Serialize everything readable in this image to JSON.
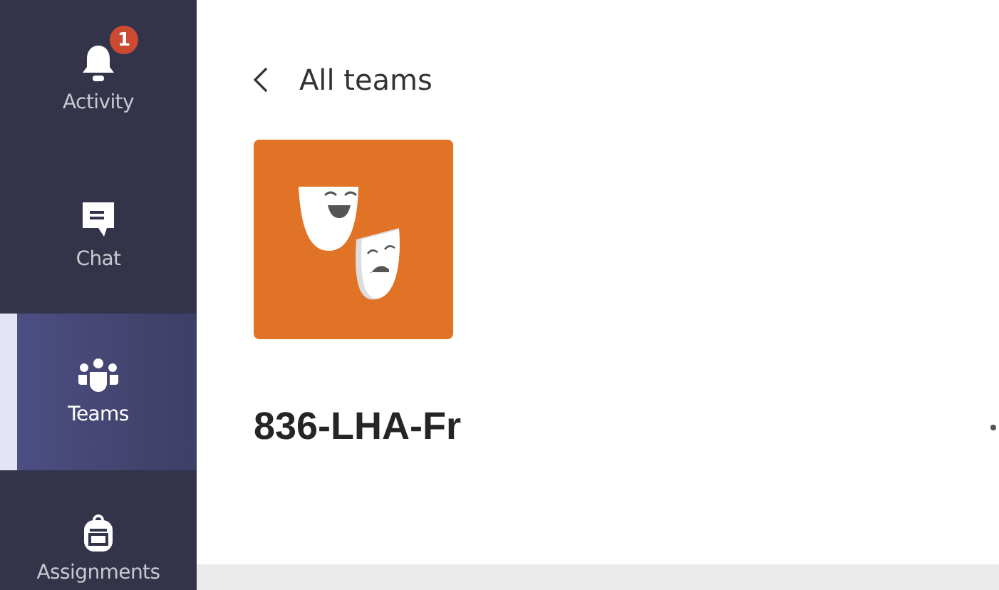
{
  "sidebar": {
    "items": [
      {
        "kind": "activity",
        "label": "Activity",
        "selected": false,
        "badge": "1"
      },
      {
        "kind": "chat",
        "label": "Chat",
        "selected": false
      },
      {
        "kind": "teams",
        "label": "Teams",
        "selected": true
      },
      {
        "kind": "assignments",
        "label": "Assignments",
        "selected": false
      }
    ]
  },
  "back_link": {
    "label": "All teams"
  },
  "team": {
    "name": "836-LHA-Fr"
  }
}
